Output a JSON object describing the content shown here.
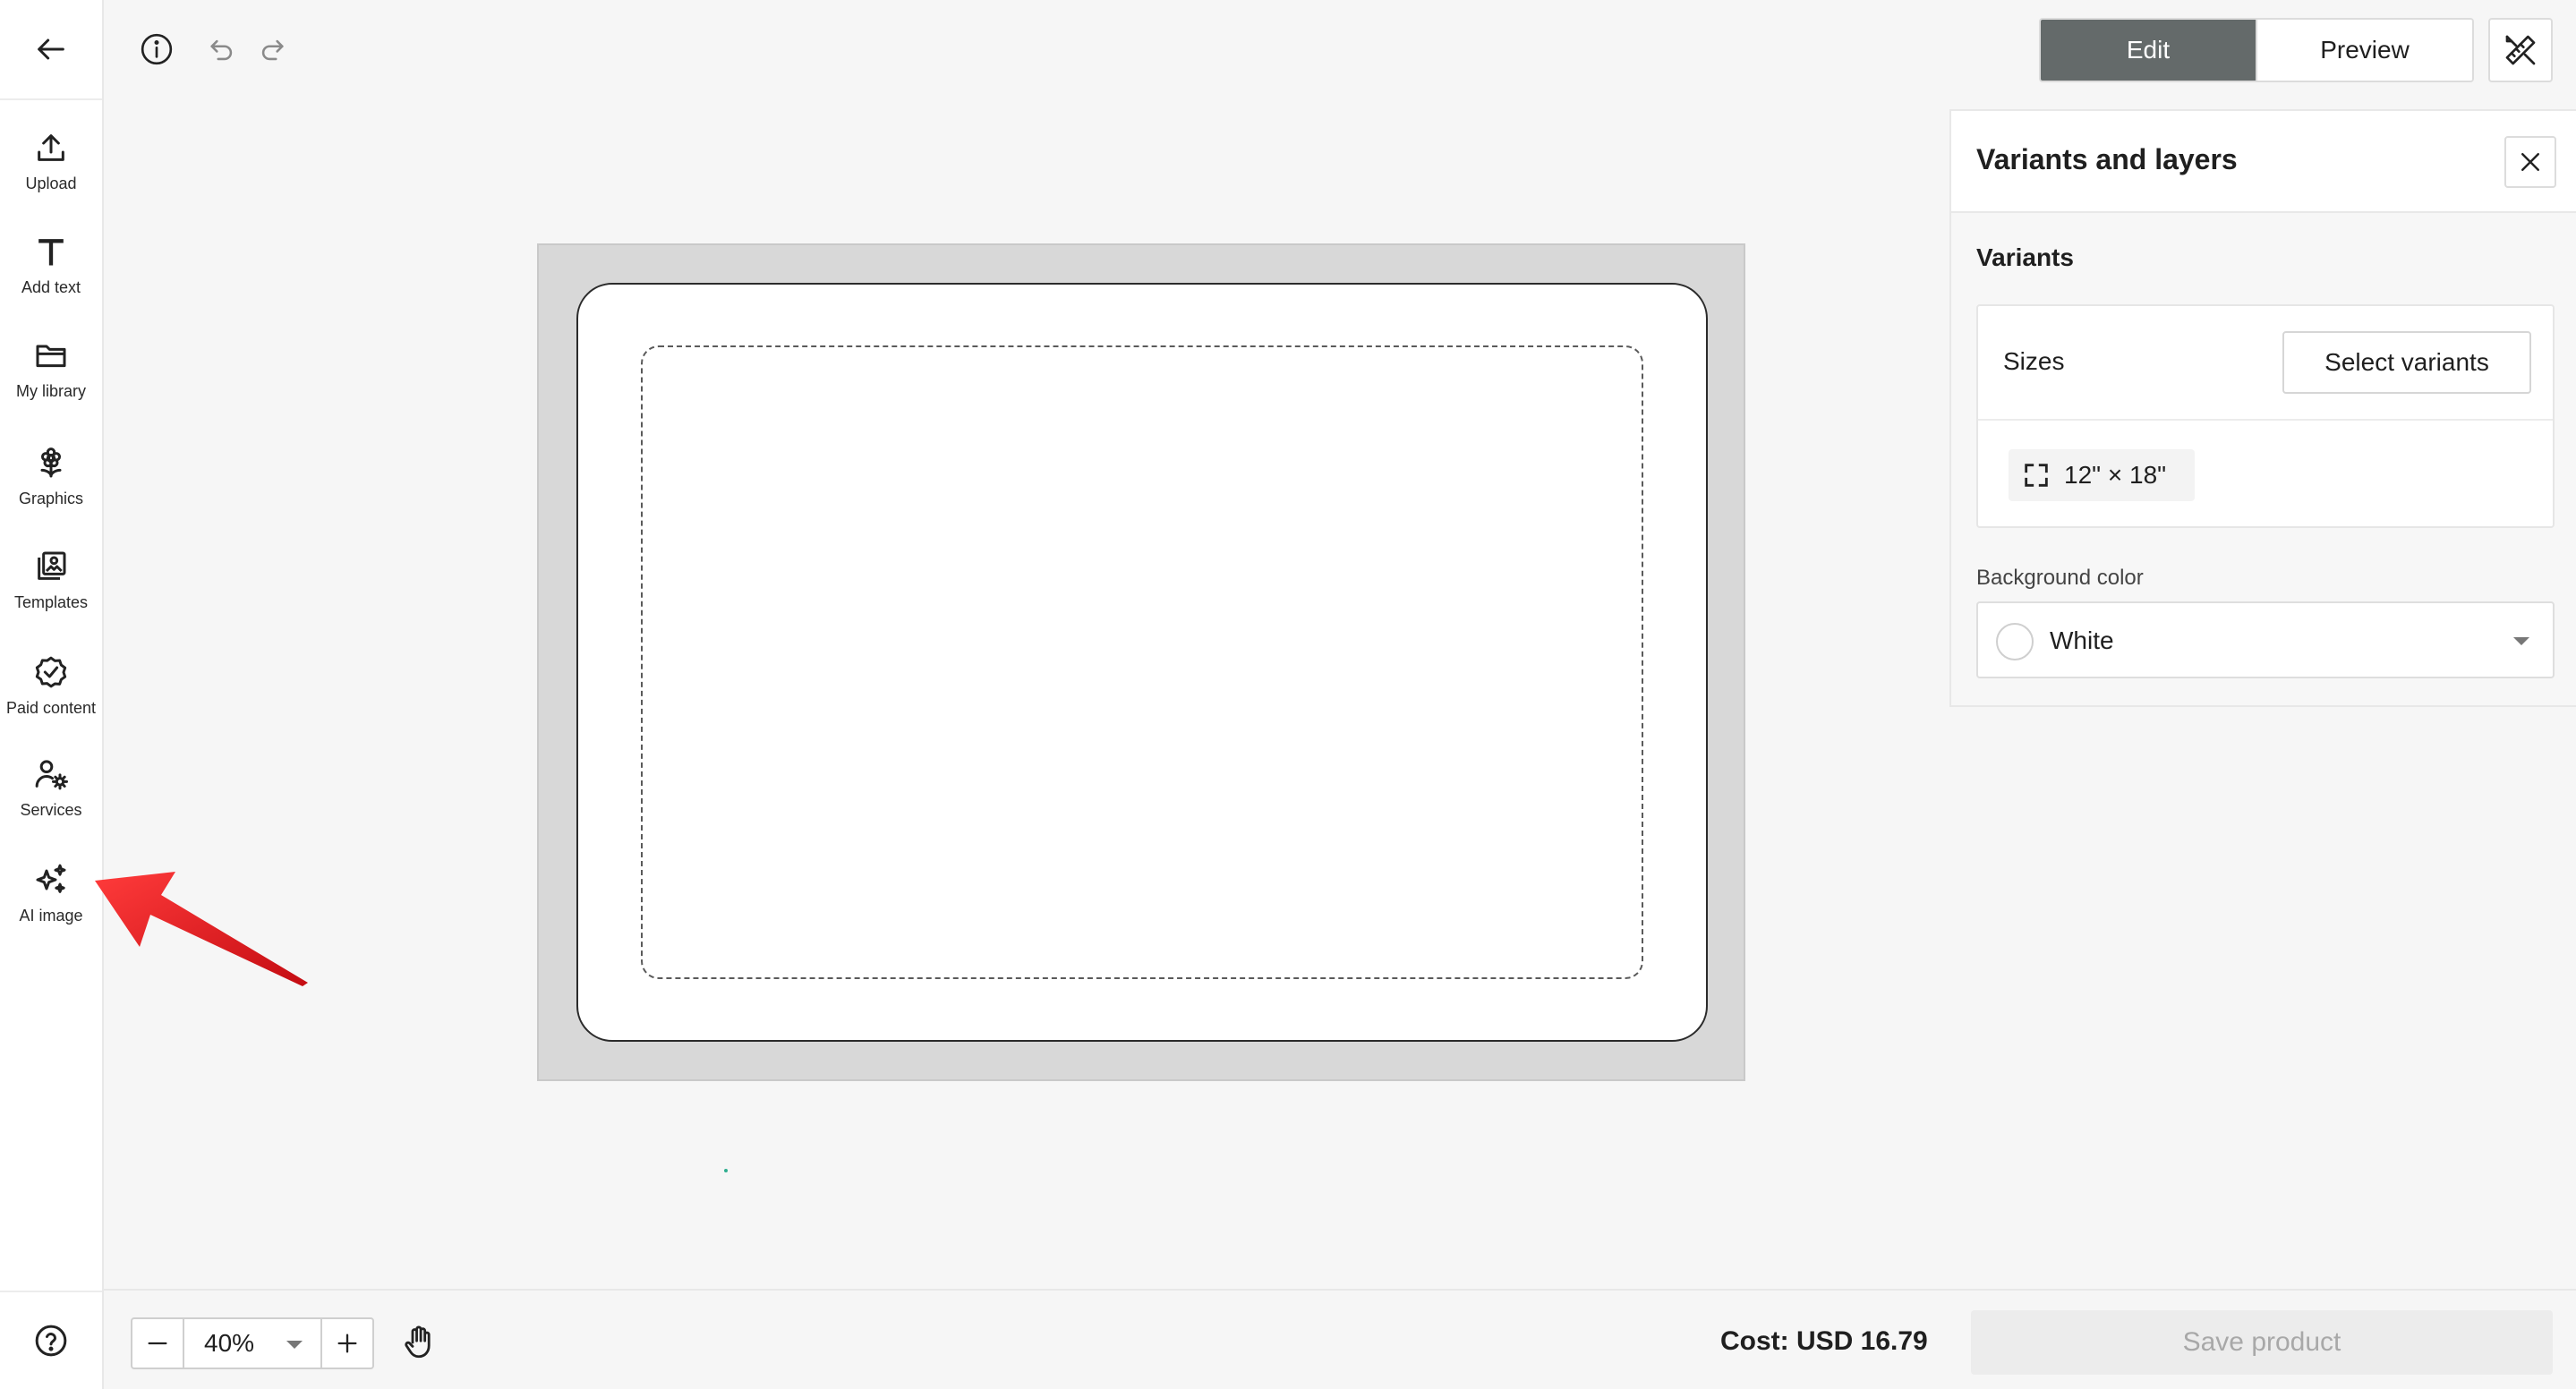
{
  "sidebar": {
    "items": [
      {
        "label": "Upload",
        "icon": "upload-icon"
      },
      {
        "label": "Add text",
        "icon": "text-icon"
      },
      {
        "label": "My library",
        "icon": "folder-icon"
      },
      {
        "label": "Graphics",
        "icon": "flower-icon"
      },
      {
        "label": "Templates",
        "icon": "templates-icon"
      },
      {
        "label": "Paid content",
        "icon": "badge-check-icon"
      },
      {
        "label": "Services",
        "icon": "user-gear-icon"
      },
      {
        "label": "AI image",
        "icon": "sparkles-icon"
      }
    ]
  },
  "toolbar": {
    "edit_label": "Edit",
    "preview_label": "Preview"
  },
  "panel": {
    "title": "Variants and layers",
    "variants_title": "Variants",
    "sizes_label": "Sizes",
    "select_variants_label": "Select variants",
    "size_value": "12\" × 18\"",
    "background_label": "Background color",
    "background_value": "White"
  },
  "bottom": {
    "zoom_value": "40%",
    "cost": "Cost: USD 16.79",
    "save_label": "Save product"
  },
  "colors": {
    "active_tab": "#646a6a",
    "annotation_arrow": "#e0141b"
  }
}
